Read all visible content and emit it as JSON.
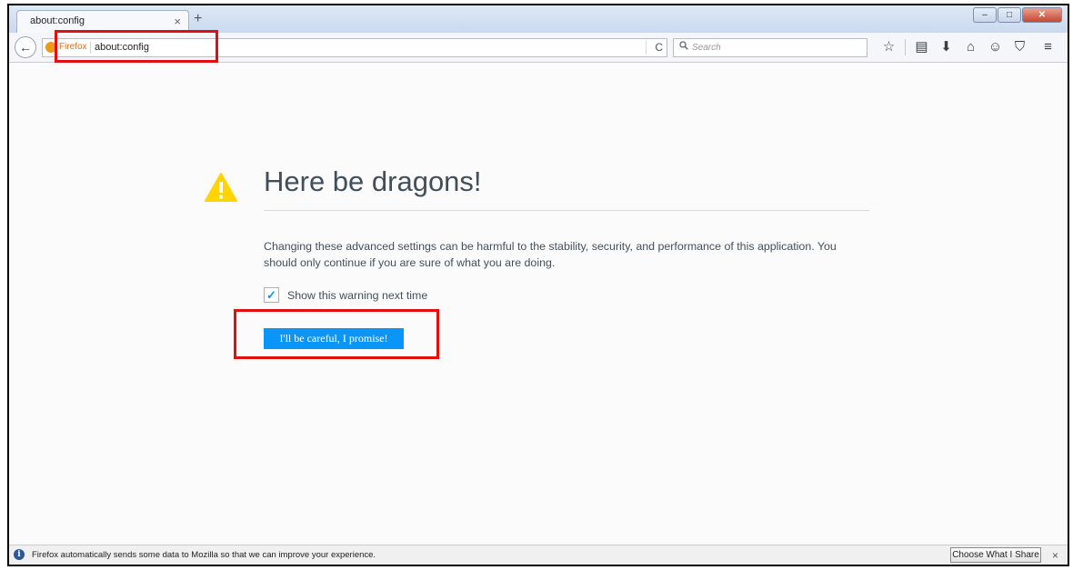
{
  "browser": {
    "tab": {
      "title": "about:config",
      "close_glyph": "×"
    },
    "new_tab_glyph": "+",
    "window_controls": {
      "minimize": "–",
      "maximize": "□",
      "close": "✕"
    },
    "nav": {
      "back_glyph": "←",
      "identity_label": "Firefox",
      "url": "about:config",
      "reload_glyph": "C",
      "search_placeholder": "Search"
    },
    "toolbar_icons": [
      {
        "name": "bookmark-star-icon",
        "glyph": "☆"
      },
      {
        "name": "reading-list-icon",
        "glyph": "▤"
      },
      {
        "name": "downloads-icon",
        "glyph": "⬇"
      },
      {
        "name": "home-icon",
        "glyph": "⌂"
      },
      {
        "name": "hello-chat-icon",
        "glyph": "☺"
      },
      {
        "name": "pocket-icon",
        "glyph": "⛉"
      },
      {
        "name": "menu-icon",
        "glyph": "≡"
      }
    ]
  },
  "page": {
    "heading": "Here be dragons!",
    "description": "Changing these advanced settings can be harmful to the stability, security, and performance of this application. You should only continue if you are sure of what you are doing.",
    "checkbox": {
      "label": "Show this warning next time",
      "checked": true,
      "check_glyph": "✓"
    },
    "primary_button": "I'll be careful, I promise!"
  },
  "notification": {
    "info_glyph": "i",
    "text": "Firefox automatically sends some data to Mozilla so that we can improve your experience.",
    "button": "Choose What I Share",
    "close_glyph": "×"
  },
  "colors": {
    "accent": "#0996f8",
    "warning": "#ffd400",
    "annotation": "#e10f0f"
  }
}
